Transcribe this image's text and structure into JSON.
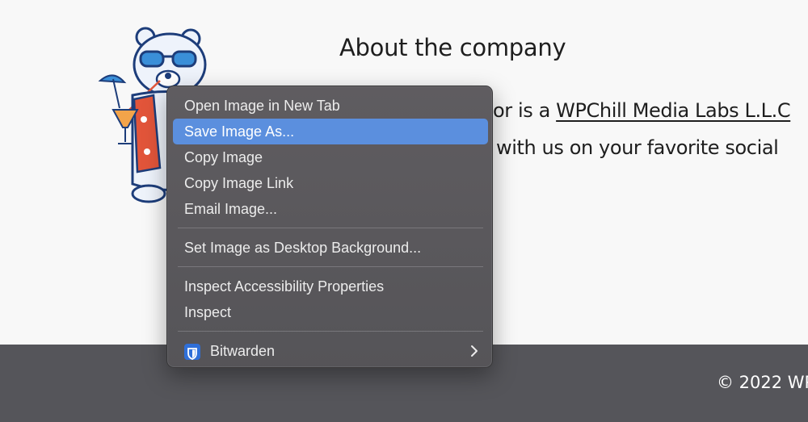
{
  "page": {
    "heading": "About the company",
    "line1_prefix": "or is a ",
    "company_link": "WPChill Media Labs L.L.C",
    "line2": "with us on your favorite social"
  },
  "footer": {
    "copyright": "© 2022 WP"
  },
  "context_menu": {
    "items": [
      {
        "label": "Open Image in New Tab"
      },
      {
        "label": "Save Image As...",
        "highlighted": true
      },
      {
        "label": "Copy Image"
      },
      {
        "label": "Copy Image Link"
      },
      {
        "label": "Email Image..."
      },
      {
        "label": "Set Image as Desktop Background..."
      },
      {
        "label": "Inspect Accessibility Properties"
      },
      {
        "label": "Inspect"
      },
      {
        "label": "Bitwarden",
        "icon": "bitwarden-shield-icon",
        "submenu_icon": "chevron-right-icon"
      }
    ]
  },
  "colors": {
    "page_background": "#f8f8f8",
    "footer_background": "#55555a",
    "menu_background": "#58565a",
    "menu_highlight": "#5b8fde",
    "bitwarden_blue": "#2f6fd8"
  }
}
